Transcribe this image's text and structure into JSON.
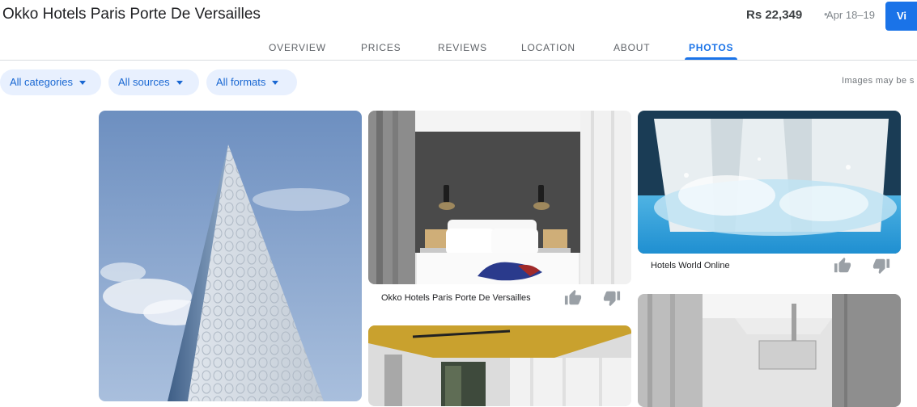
{
  "header": {
    "title": "Okko Hotels Paris Porte De Versailles",
    "price": "Rs 22,349",
    "separator": "•",
    "dates": "Apr 18–19",
    "view_button": "Vi"
  },
  "tabs": [
    {
      "label": "OVERVIEW"
    },
    {
      "label": "PRICES"
    },
    {
      "label": "REVIEWS"
    },
    {
      "label": "LOCATION"
    },
    {
      "label": "ABOUT"
    },
    {
      "label": "PHOTOS",
      "active": true
    }
  ],
  "filters": [
    {
      "label": "All categories"
    },
    {
      "label": "All sources"
    },
    {
      "label": "All formats"
    }
  ],
  "notice": "Images may be s",
  "photos": [
    {
      "caption": ""
    },
    {
      "caption": "Okko Hotels Paris Porte De Versailles"
    },
    {
      "caption": "Hotels World Online"
    },
    {
      "caption": ""
    },
    {
      "caption": ""
    }
  ],
  "colors": {
    "accent": "#1a73e8",
    "chip_bg": "#e8f0fe",
    "thumb_icon": "#9aa0a6"
  },
  "icons": {
    "thumb_up": "thumb-up-icon",
    "thumb_down": "thumb-down-icon",
    "caret": "caret-down-icon"
  }
}
